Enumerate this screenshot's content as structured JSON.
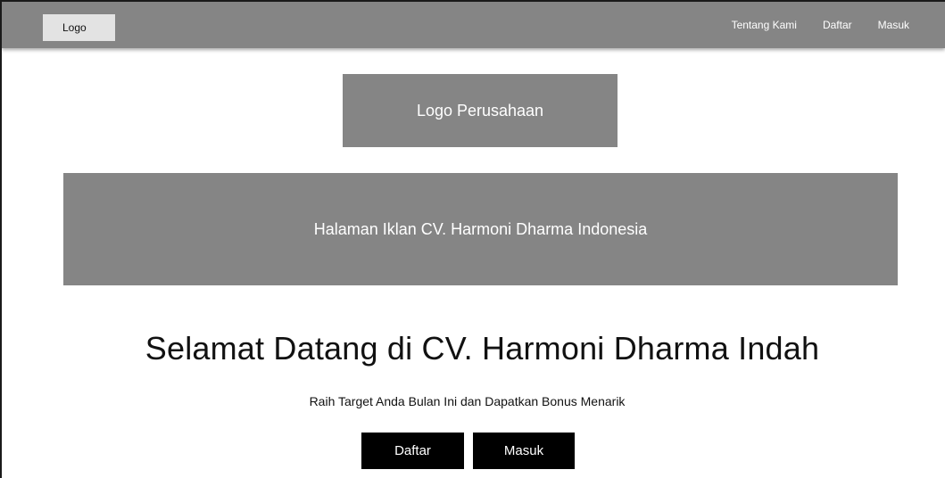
{
  "navbar": {
    "logo_label": "Logo",
    "links": [
      "Tentang Kami",
      "Daftar",
      "Masuk"
    ]
  },
  "main": {
    "company_logo_label": "Logo Perusahaan",
    "ad_banner_label": "Halaman Iklan CV. Harmoni Dharma Indonesia",
    "title": "Selamat Datang di CV. Harmoni Dharma Indah",
    "subtitle": "Raih Target Anda Bulan Ini dan Dapatkan Bonus Menarik",
    "buttons": {
      "register_label": "Daftar",
      "login_label": "Masuk"
    }
  },
  "colors": {
    "navbar_bg": "#858585",
    "placeholder_bg": "#858585",
    "button_bg": "#000000",
    "logo_bg": "#e3e3e3"
  }
}
